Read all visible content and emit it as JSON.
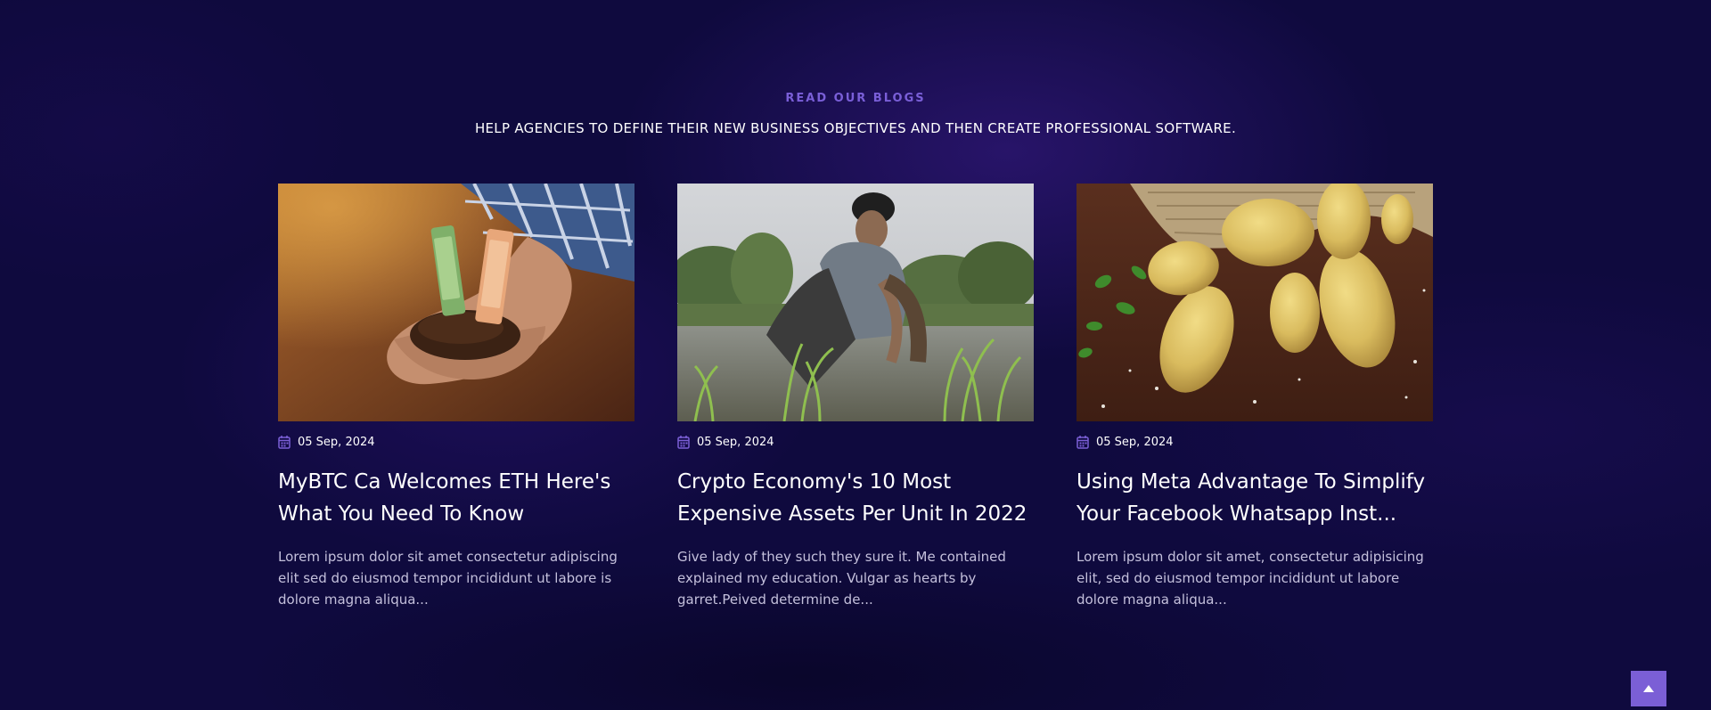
{
  "header": {
    "eyebrow": "READ OUR BLOGS",
    "subtitle": "HELP AGENCIES TO DEFINE THEIR NEW BUSINESS OBJECTIVES AND THEN CREATE PROFESSIONAL SOFTWARE."
  },
  "posts": [
    {
      "image_icon": "hands-soil-money-photo",
      "date": "05 Sep, 2024",
      "title": "MyBTC Ca Welcomes ETH Here's What You Need To Know",
      "excerpt": "Lorem ipsum dolor sit amet consectetur adipiscing elit sed do eiusmod tempor incididunt ut labore is dolore magna aliqua..."
    },
    {
      "image_icon": "farmer-rice-field-photo",
      "date": "05 Sep, 2024",
      "title": "Crypto Economy's 10 Most Expensive Assets Per Unit In 2022",
      "excerpt": "Give lady of they such they sure it. Me contained explained my education. Vulgar as hearts by garret.Peived determine de..."
    },
    {
      "image_icon": "potatoes-sack-photo",
      "date": "05 Sep, 2024",
      "title": "Using Meta Advantage To Simplify Your Facebook Whatsapp Inst...",
      "excerpt": "Lorem ipsum dolor sit amet, consectetur adipisicing elit, sed do eiusmod tempor incididunt ut labore dolore magna aliqua..."
    }
  ],
  "colors": {
    "background": "#0f0a3e",
    "accent": "#7b5fd6",
    "text": "#ffffff",
    "muted_text": "#c4c0dc"
  },
  "scroll_top_icon": "arrow-up-icon"
}
